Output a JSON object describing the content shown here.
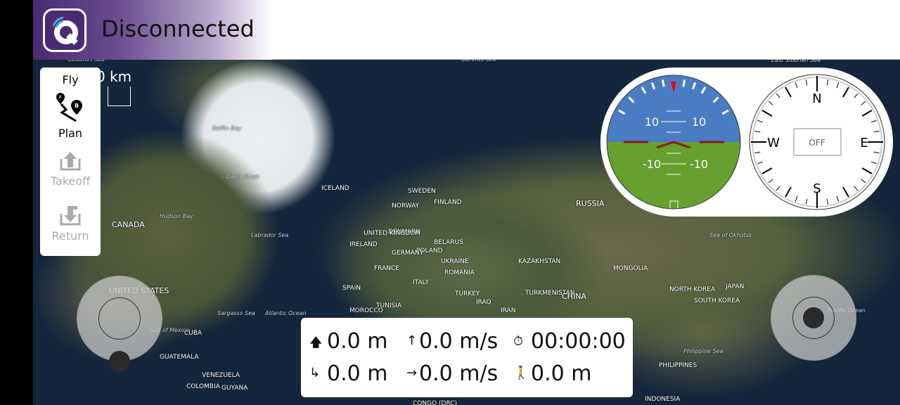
{
  "header": {
    "status": "Disconnected"
  },
  "map": {
    "scale_label": "0 km",
    "labels": [
      {
        "t": "Beaufort Sea",
        "c": "sea"
      },
      {
        "t": "Baffin Bay",
        "c": "sea"
      },
      {
        "t": "Davis Strait",
        "c": "sea"
      },
      {
        "t": "Hudson Bay",
        "c": "sea"
      },
      {
        "t": "CANADA",
        "c": "big"
      },
      {
        "t": "Labrador Sea",
        "c": "sea"
      },
      {
        "t": "UNITED STATES",
        "c": "big"
      },
      {
        "t": "Gulf of Mexico",
        "c": "sea"
      },
      {
        "t": "Sargasso Sea",
        "c": "sea"
      },
      {
        "t": "Atlantic Ocean",
        "c": "sea"
      },
      {
        "t": "Barents Sea",
        "c": "sea"
      },
      {
        "t": "East Siberian Sea",
        "c": "sea"
      },
      {
        "t": "ICELAND",
        "c": ""
      },
      {
        "t": "SWEDEN",
        "c": ""
      },
      {
        "t": "FINLAND",
        "c": ""
      },
      {
        "t": "NORWAY",
        "c": ""
      },
      {
        "t": "DENMARK",
        "c": ""
      },
      {
        "t": "UNITED KINGDOM",
        "c": ""
      },
      {
        "t": "IRELAND",
        "c": ""
      },
      {
        "t": "BELARUS",
        "c": ""
      },
      {
        "t": "POLAND",
        "c": ""
      },
      {
        "t": "GERMANY",
        "c": ""
      },
      {
        "t": "UKRAINE",
        "c": ""
      },
      {
        "t": "FRANCE",
        "c": ""
      },
      {
        "t": "ROMANIA",
        "c": ""
      },
      {
        "t": "ITALY",
        "c": ""
      },
      {
        "t": "SPAIN",
        "c": ""
      },
      {
        "t": "TURKEY",
        "c": ""
      },
      {
        "t": "TUNISIA",
        "c": ""
      },
      {
        "t": "MOROCCO",
        "c": ""
      },
      {
        "t": "IRAQ",
        "c": ""
      },
      {
        "t": "IRAN",
        "c": ""
      },
      {
        "t": "TURKMENISTAN",
        "c": ""
      },
      {
        "t": "KAZAKHSTAN",
        "c": ""
      },
      {
        "t": "MONGOLIA",
        "c": ""
      },
      {
        "t": "RUSSIA",
        "c": "big"
      },
      {
        "t": "CHINA",
        "c": "big"
      },
      {
        "t": "NORTH KOREA",
        "c": ""
      },
      {
        "t": "SOUTH KOREA",
        "c": ""
      },
      {
        "t": "JAPAN",
        "c": ""
      },
      {
        "t": "Sea of Okhotsk",
        "c": "sea"
      },
      {
        "t": "Pacific Ocean",
        "c": "sea"
      },
      {
        "t": "Philippine Sea",
        "c": "sea"
      },
      {
        "t": "PHILIPPINES",
        "c": ""
      },
      {
        "t": "INDONESIA",
        "c": ""
      },
      {
        "t": "CUBA",
        "c": ""
      },
      {
        "t": "GUATEMALA",
        "c": ""
      },
      {
        "t": "VENEZUELA",
        "c": ""
      },
      {
        "t": "COLOMBIA",
        "c": ""
      },
      {
        "t": "GUYANA",
        "c": ""
      },
      {
        "t": "CONGO (DRC)",
        "c": ""
      }
    ]
  },
  "toolbar": {
    "items": [
      {
        "label": "Fly",
        "enabled": true
      },
      {
        "label": "Plan",
        "enabled": true,
        "icon": "route-ab-icon"
      },
      {
        "label": "Takeoff",
        "enabled": false,
        "icon": "takeoff-icon"
      },
      {
        "label": "Return",
        "enabled": false,
        "icon": "return-icon"
      }
    ]
  },
  "attitude": {
    "pitch_labels": [
      "10",
      "10",
      "-10",
      "-10"
    ],
    "sky_color": "#4a7cc4",
    "ground_color": "#66a02e",
    "marker_color": "#8b1a1a"
  },
  "compass": {
    "n": "N",
    "e": "E",
    "s": "S",
    "w": "W",
    "heading": "OFF"
  },
  "telemetry": {
    "altitude": "0.0 m",
    "vertical_speed": "0.0 m/s",
    "flight_time": "00:00:00",
    "distance_home": "0.0 m",
    "horizontal_speed": "0.0 m/s",
    "distance_gcs": "0.0 m"
  }
}
